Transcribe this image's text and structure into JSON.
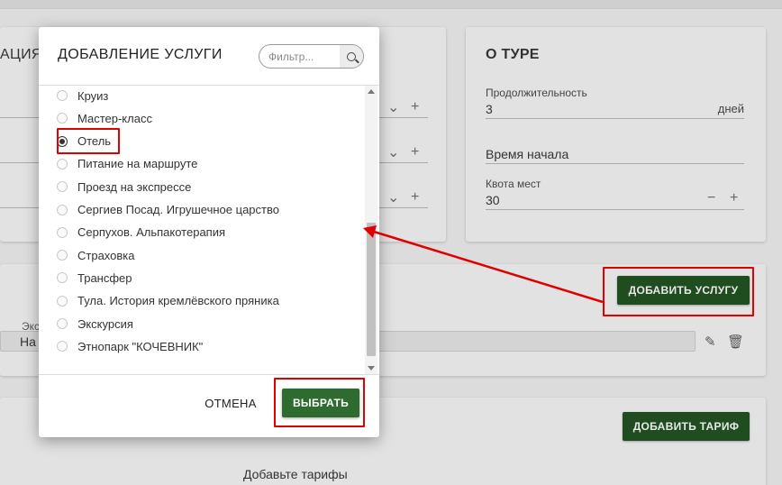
{
  "background": {
    "left_card": {
      "title_partial": "АЦИЯ"
    },
    "about_tour": {
      "title": "О ТУРЕ",
      "duration_label": "Продолжительность",
      "duration_value": "3",
      "duration_unit": "дней",
      "start_time_label": "Время начала",
      "quota_label": "Квота мест",
      "quota_value": "30"
    },
    "services": {
      "add_service_label": "ДОБАВИТЬ УСЛУГУ",
      "field_label_partial": "Экс",
      "field_value_partial": "На"
    },
    "tariffs": {
      "add_tariff_label": "ДОБАВИТЬ ТАРИФ",
      "empty_text": "Добавьте тарифы"
    }
  },
  "modal": {
    "title": "ДОБАВЛЕНИЕ УСЛУГИ",
    "filter_placeholder": "Фильтр...",
    "items": [
      {
        "label": "Круиз",
        "checked": false
      },
      {
        "label": "Мастер-класс",
        "checked": false
      },
      {
        "label": "Отель",
        "checked": true
      },
      {
        "label": "Питание на маршруте",
        "checked": false
      },
      {
        "label": "Проезд на экспрессе",
        "checked": false
      },
      {
        "label": "Сергиев Посад. Игрушечное царство",
        "checked": false
      },
      {
        "label": "Серпухов. Альпакотерапия",
        "checked": false
      },
      {
        "label": "Страховка",
        "checked": false
      },
      {
        "label": "Трансфер",
        "checked": false
      },
      {
        "label": "Тула. История кремлёвского пряника",
        "checked": false
      },
      {
        "label": "Экскурсия",
        "checked": false
      },
      {
        "label": "Этнопарк \"КОЧЕВНИК\"",
        "checked": false
      }
    ],
    "cancel_label": "ОТМЕНА",
    "select_label": "ВЫБРАТЬ"
  },
  "colors": {
    "primary_green": "#2e6b2f",
    "annotation_red": "#e00000"
  }
}
